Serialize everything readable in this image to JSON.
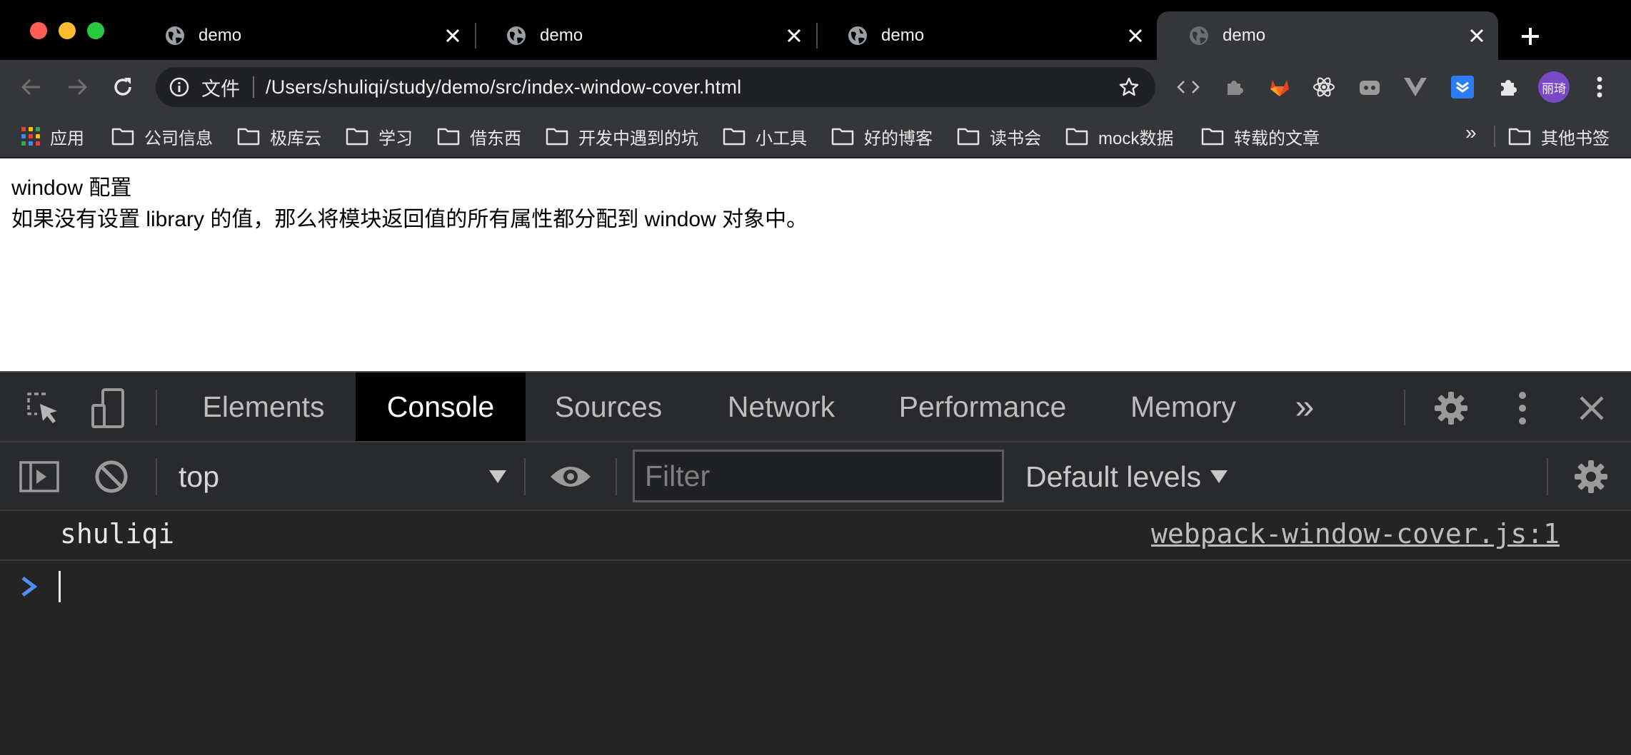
{
  "tabs": [
    {
      "title": "demo",
      "active": false
    },
    {
      "title": "demo",
      "active": false
    },
    {
      "title": "demo",
      "active": false
    },
    {
      "title": "demo",
      "active": true
    }
  ],
  "address_bar": {
    "scheme_label": "文件",
    "url": "/Users/shuliqi/study/demo/src/index-window-cover.html"
  },
  "profile": {
    "initials": "丽琦"
  },
  "bookmarks": {
    "apps_label": "应用",
    "items": [
      "公司信息",
      "极库云",
      "学习",
      "借东西",
      "开发中遇到的坑",
      "小工具",
      "好的博客",
      "读书会",
      "mock数据",
      "转载的文章"
    ],
    "overflow": "»",
    "other": "其他书签"
  },
  "page": {
    "line1": "window 配置",
    "line2": "如果没有设置 library 的值，那么将模块返回值的所有属性都分配到 window 对象中。"
  },
  "devtools": {
    "tabs": [
      "Elements",
      "Console",
      "Sources",
      "Network",
      "Performance",
      "Memory"
    ],
    "more": "»",
    "context": "top",
    "filter_placeholder": "Filter",
    "levels": "Default levels",
    "messages": [
      {
        "text": "shuliqi",
        "source": "webpack-window-cover.js:1"
      }
    ]
  },
  "colors": {
    "tab_active": "#35363a",
    "chrome_bg": "#000000",
    "devtools_bg": "#242424",
    "prompt_blue": "#4e8ff7",
    "avatar": "#7a49c6"
  }
}
